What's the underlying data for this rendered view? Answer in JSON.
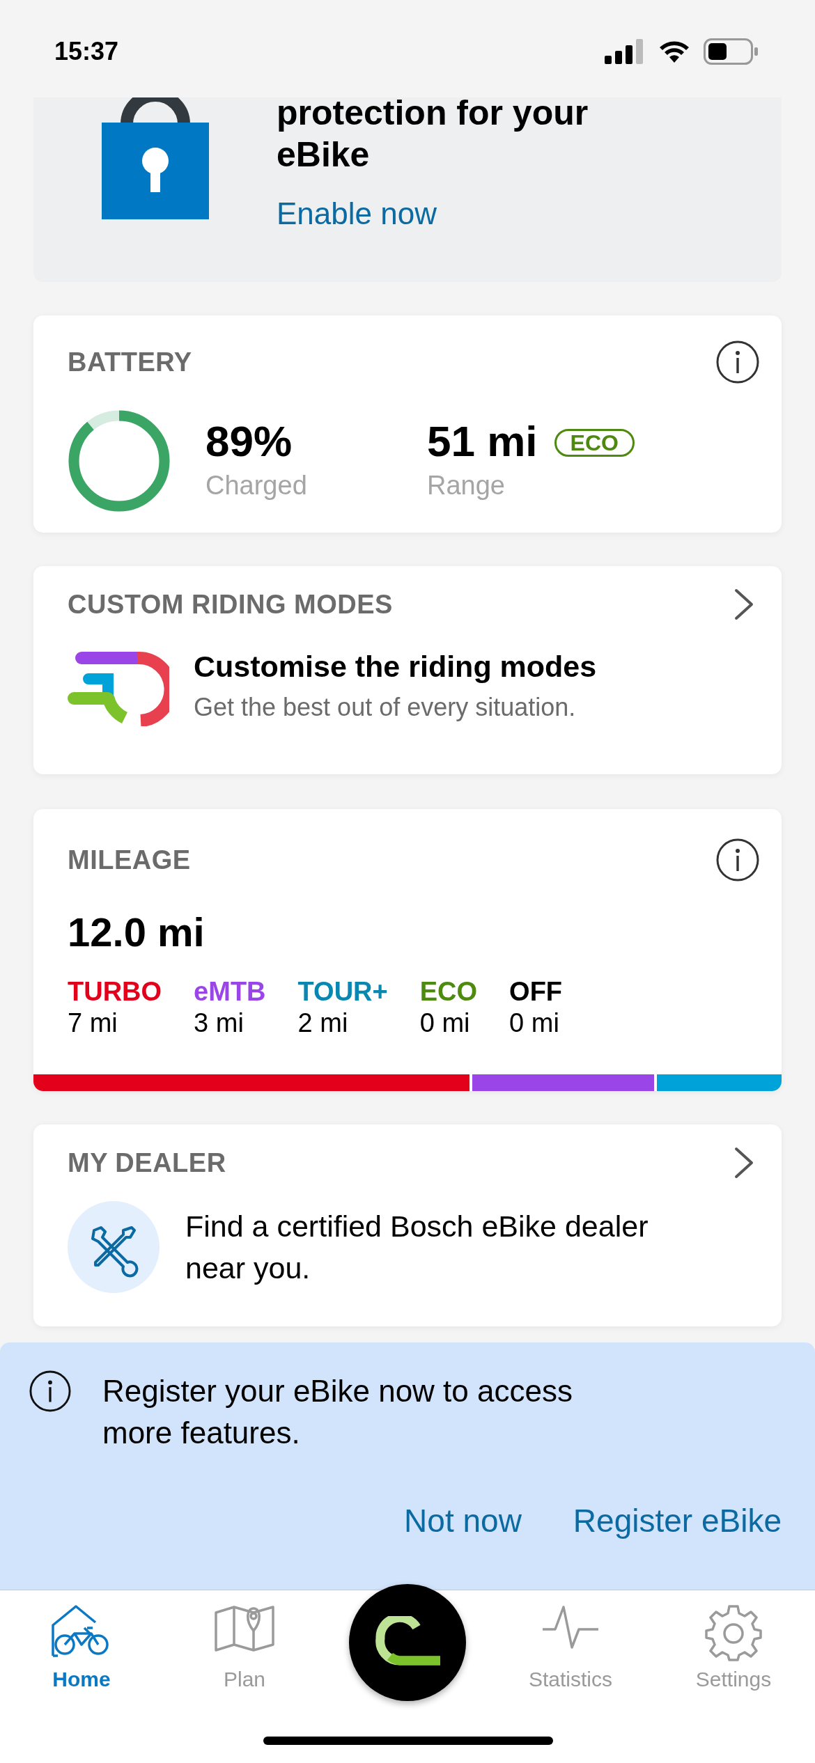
{
  "status_bar": {
    "time": "15:37"
  },
  "promo": {
    "title": "protection for your eBike",
    "link": "Enable now"
  },
  "battery": {
    "title": "BATTERY",
    "level": 0.89,
    "charge": "89%",
    "charge_label": "Charged",
    "range": "51 mi",
    "mode_badge": "ECO",
    "range_label": "Range"
  },
  "riding_modes": {
    "title": "CUSTOM RIDING MODES",
    "heading": "Customise the riding modes",
    "subtitle": "Get the best out of every situation."
  },
  "mileage": {
    "title": "MILEAGE",
    "total": "12.0 mi",
    "modes": [
      {
        "name": "TURBO",
        "distance": "7 mi",
        "color": "#e2001a"
      },
      {
        "name": "eMTB",
        "distance": "3 mi",
        "color": "#9a45e8"
      },
      {
        "name": "TOUR+",
        "distance": "2 mi",
        "color": "#0a87b0"
      },
      {
        "name": "ECO",
        "distance": "0 mi",
        "color": "#4f8a10"
      },
      {
        "name": "OFF",
        "distance": "0 mi",
        "color": "#000000"
      }
    ],
    "bar_segments": [
      {
        "color": "#e2001a",
        "level": 0.583
      },
      {
        "color": "#9a45e8"
      },
      {
        "color": "#00a3d9",
        "level": 0.167
      }
    ]
  },
  "dealer": {
    "title": "MY DEALER",
    "text": "Find a certified Bosch eBike dealer near you."
  },
  "banner": {
    "message": "Register your eBike now to access more features.",
    "buttons": [
      "Not now",
      "Register eBike"
    ]
  },
  "tabs": [
    {
      "kind": "home",
      "label": "Home",
      "selected": true
    },
    {
      "kind": "plan",
      "label": "Plan",
      "selected": false
    },
    {
      "kind": "ride",
      "selected": false
    },
    {
      "kind": "statistics",
      "label": "Statistics",
      "selected": false
    },
    {
      "kind": "settings",
      "label": "Settings",
      "selected": false
    }
  ]
}
